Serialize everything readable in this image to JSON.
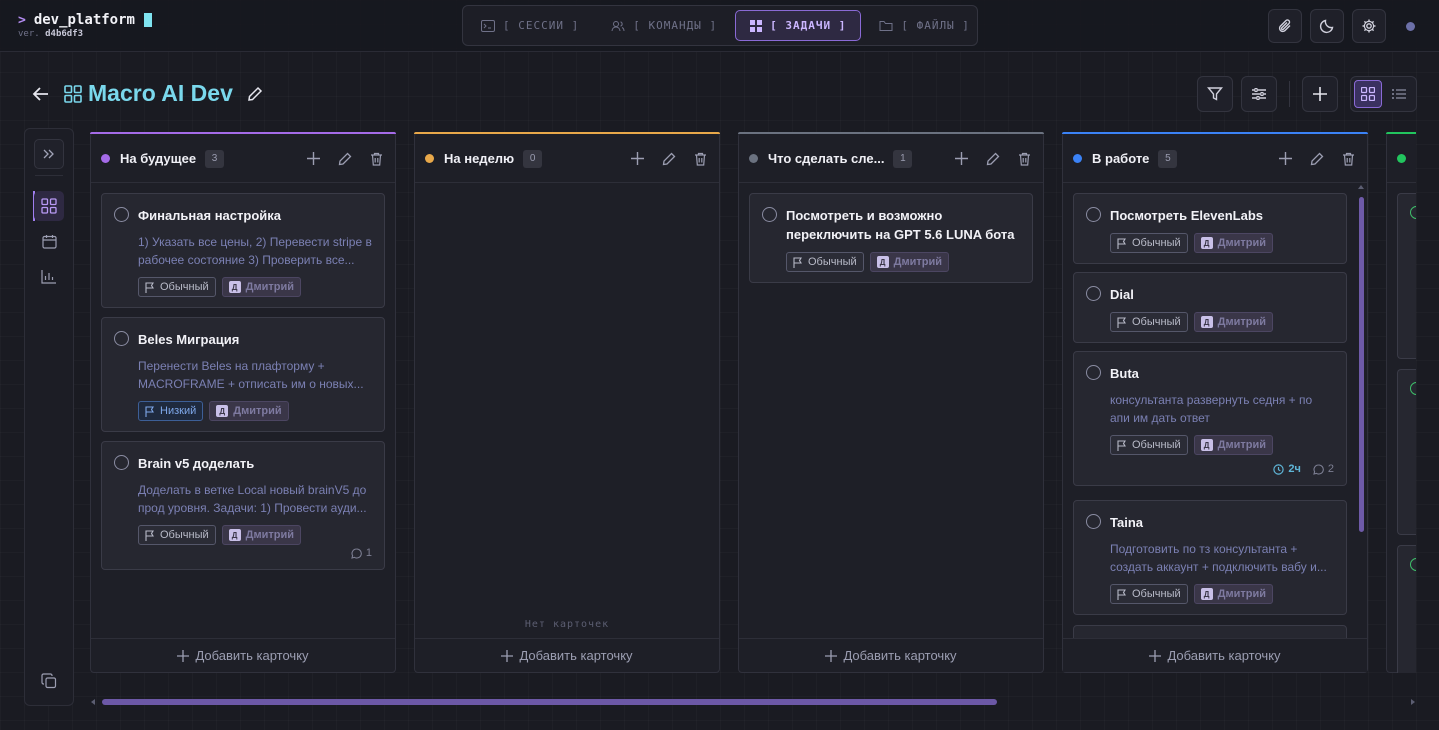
{
  "app": {
    "prompt": ">",
    "name": "dev_platform",
    "version_label": "ver.",
    "version": "d4b6df3"
  },
  "nav": {
    "tabs": [
      {
        "label": "[ СЕССИИ ]",
        "icon": "terminal-icon",
        "active": false
      },
      {
        "label": "[ КОМАНДЫ ]",
        "icon": "users-icon",
        "active": false
      },
      {
        "label": "[ ЗАДАЧИ ]",
        "icon": "grid-icon",
        "active": true
      },
      {
        "label": "[ ФАЙЛЫ ]",
        "icon": "folder-icon",
        "active": false
      }
    ]
  },
  "project": {
    "title": "Macro AI Dev"
  },
  "columns": [
    {
      "title": "На будущее",
      "count": "3",
      "color": "#a56be8",
      "footer": "Добавить карточку",
      "cards": [
        {
          "title": "Финальная настройка",
          "desc": "1) Указать все цены, 2) Перевести stripe в рабочее состояние 3) Проверить все...",
          "priority": "Обычный",
          "user": "Дмитрий",
          "avatar": "Д"
        },
        {
          "title": "Beles Миграция",
          "desc": "Перенести Beles на плафторму + MACROFRAME + отписать им о новых...",
          "priority": "Низкий",
          "user": "Дмитрий",
          "avatar": "Д"
        },
        {
          "title": "Brain v5 доделать",
          "desc": "Доделать в ветке Local новый brainV5 до прод уровня. Задачи: 1) Провести ауди...",
          "priority": "Обычный",
          "user": "Дмитрий",
          "avatar": "Д",
          "comments": "1"
        }
      ]
    },
    {
      "title": "На неделю",
      "count": "0",
      "color": "#e8a84a",
      "empty_text": "Нет карточек",
      "footer": "Добавить карточку"
    },
    {
      "title": "Что сделать сле...",
      "count": "1",
      "color": "#6b7280",
      "footer": "Добавить карточку",
      "cards": [
        {
          "title": "Посмотреть и возможно переключить на GPT 5.6 LUNA бота",
          "priority": "Обычный",
          "user": "Дмитрий",
          "avatar": "Д"
        }
      ]
    },
    {
      "title": "В работе",
      "count": "5",
      "color": "#3b82f6",
      "footer": "Добавить карточку",
      "cards": [
        {
          "title": "Посмотреть ElevenLabs",
          "priority": "Обычный",
          "user": "Дмитрий",
          "avatar": "Д"
        },
        {
          "title": "Dial",
          "priority": "Обычный",
          "user": "Дмитрий",
          "avatar": "Д"
        },
        {
          "title": "Buta",
          "desc": "консультанта развернуть седня + по апи им дать ответ",
          "priority": "Обычный",
          "user": "Дмитрий",
          "avatar": "Д",
          "time": "2ч",
          "comments": "2"
        },
        {
          "title": "Taina",
          "desc": "Подготовить по тз консультанта + создать аккаунт + подключить вабу и...",
          "priority": "Обычный",
          "user": "Дмитрий",
          "avatar": "Д"
        }
      ]
    },
    {
      "color": "#22c55e"
    }
  ]
}
